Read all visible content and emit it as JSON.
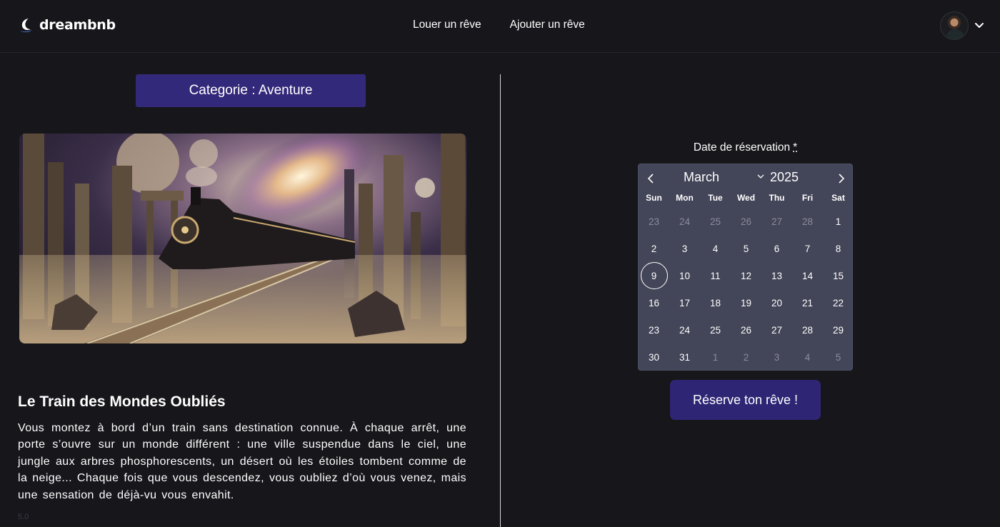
{
  "header": {
    "logo_text": "dreambnb",
    "nav": [
      {
        "label": "Louer un rêve"
      },
      {
        "label": "Ajouter un rêve"
      }
    ]
  },
  "listing": {
    "category": "Categorie : Aventure",
    "title": "Le Train des Mondes Oubliés",
    "description": "Vous montez à bord d’un train sans destination connue. À chaque arrêt, une porte s’ouvre sur un monde différent : une ville suspendue dans le ciel, une jungle aux arbres phosphorescents, un désert où les étoiles tombent comme de la neige... Chaque fois que vous descendez, vous oubliez d’où vous venez, mais une sensation de déjà-vu vous envahit.",
    "rating": "5.0"
  },
  "booking": {
    "date_label": "Date de réservation",
    "required_mark": "*",
    "month": "March",
    "year": "2025",
    "weekdays": [
      "Sun",
      "Mon",
      "Tue",
      "Wed",
      "Thu",
      "Fri",
      "Sat"
    ],
    "days": [
      {
        "d": "23",
        "muted": true
      },
      {
        "d": "24",
        "muted": true
      },
      {
        "d": "25",
        "muted": true
      },
      {
        "d": "26",
        "muted": true
      },
      {
        "d": "27",
        "muted": true
      },
      {
        "d": "28",
        "muted": true
      },
      {
        "d": "1"
      },
      {
        "d": "2"
      },
      {
        "d": "3"
      },
      {
        "d": "4"
      },
      {
        "d": "5"
      },
      {
        "d": "6"
      },
      {
        "d": "7"
      },
      {
        "d": "8"
      },
      {
        "d": "9",
        "today": true
      },
      {
        "d": "10"
      },
      {
        "d": "11"
      },
      {
        "d": "12"
      },
      {
        "d": "13"
      },
      {
        "d": "14"
      },
      {
        "d": "15"
      },
      {
        "d": "16"
      },
      {
        "d": "17"
      },
      {
        "d": "18"
      },
      {
        "d": "19"
      },
      {
        "d": "20"
      },
      {
        "d": "21"
      },
      {
        "d": "22"
      },
      {
        "d": "23"
      },
      {
        "d": "24"
      },
      {
        "d": "25"
      },
      {
        "d": "26"
      },
      {
        "d": "27"
      },
      {
        "d": "28"
      },
      {
        "d": "29"
      },
      {
        "d": "30"
      },
      {
        "d": "31"
      },
      {
        "d": "1",
        "muted": true
      },
      {
        "d": "2",
        "muted": true
      },
      {
        "d": "3",
        "muted": true
      },
      {
        "d": "4",
        "muted": true
      },
      {
        "d": "5",
        "muted": true
      }
    ],
    "submit_label": "Réserve ton rêve !"
  },
  "colors": {
    "background": "#16161b",
    "accent": "#33297a",
    "calendar_bg": "#434558"
  }
}
